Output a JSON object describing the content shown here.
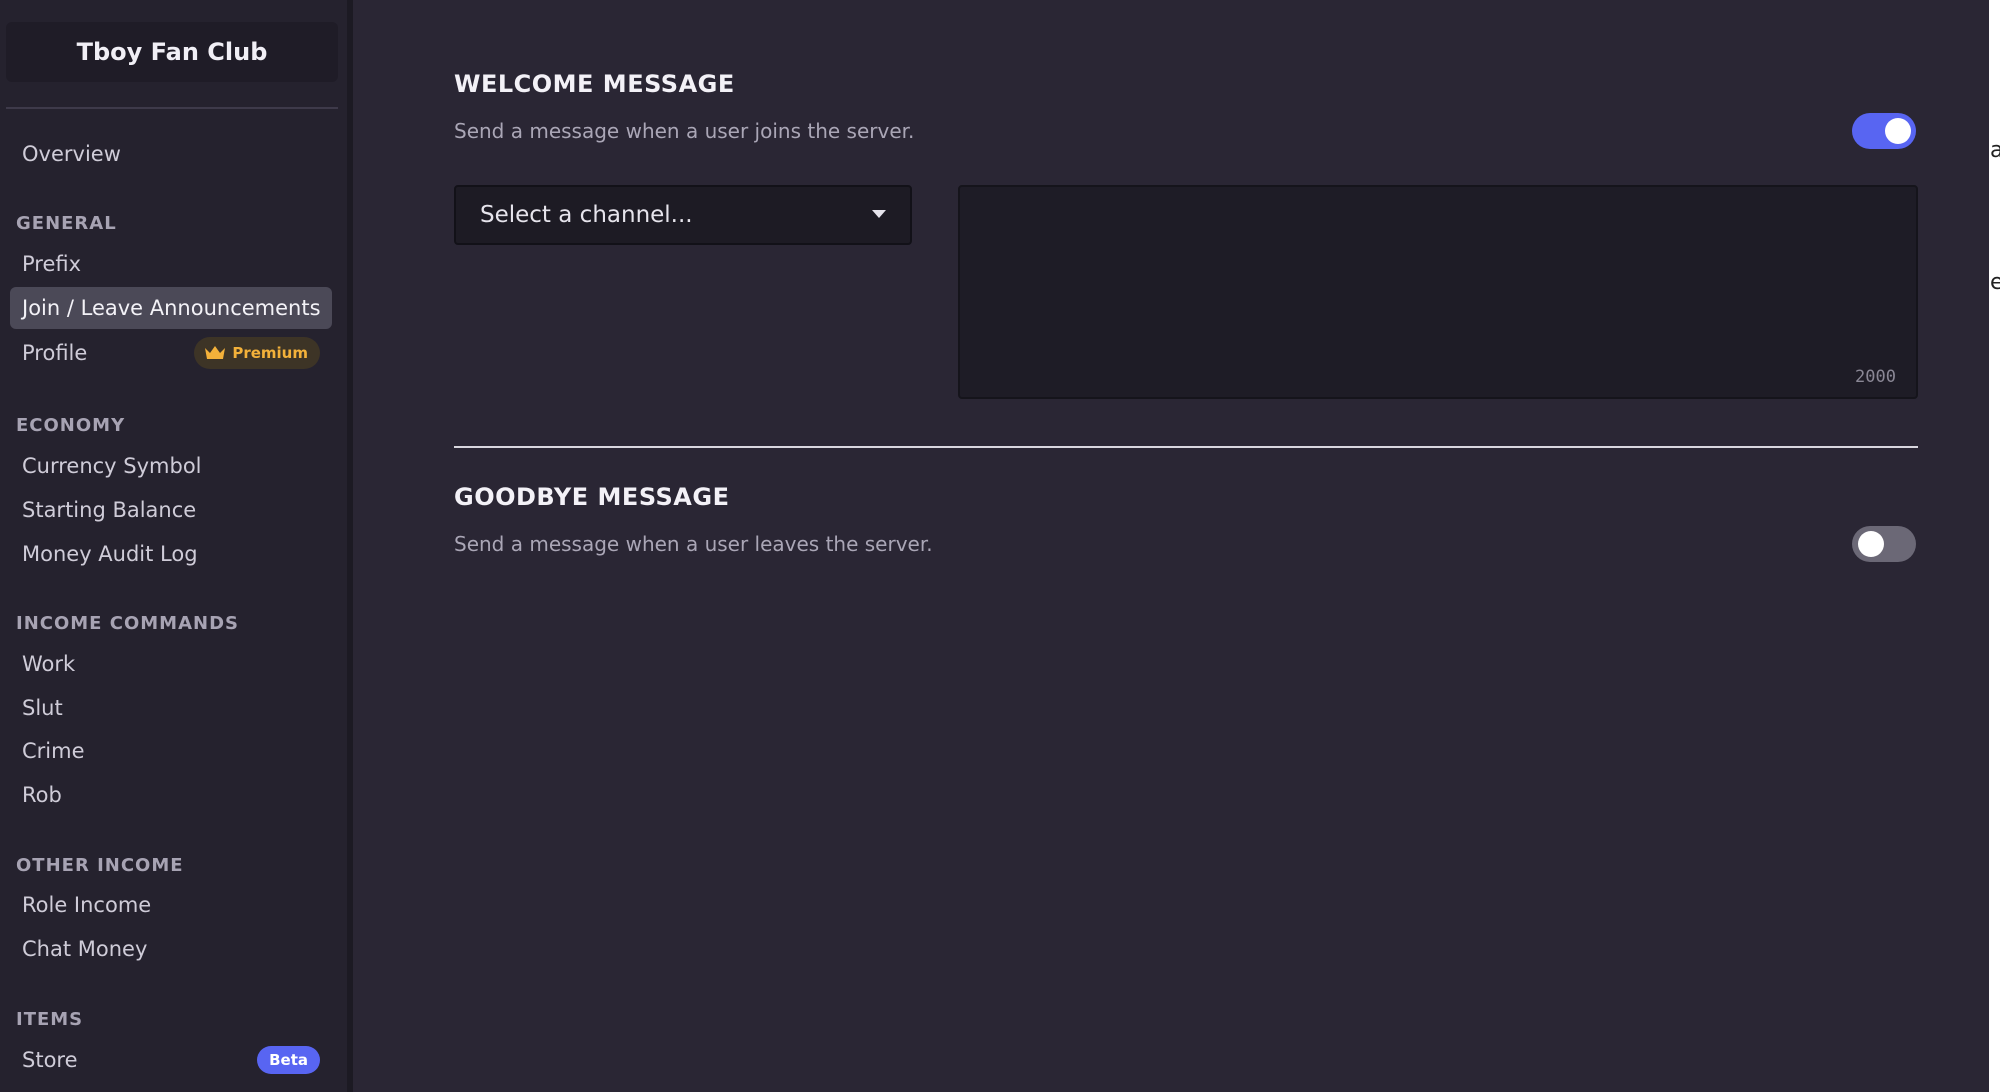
{
  "sidebar": {
    "server_name": "Tboy Fan Club",
    "overview": "Overview",
    "sections": {
      "general": "GENERAL",
      "economy": "ECONOMY",
      "income_commands": "INCOME COMMANDS",
      "other_income": "OTHER INCOME",
      "items": "ITEMS"
    },
    "items": {
      "prefix": "Prefix",
      "join_leave": "Join / Leave Announcements",
      "profile": "Profile",
      "premium_badge": "Premium",
      "currency_symbol": "Currency Symbol",
      "starting_balance": "Starting Balance",
      "money_audit_log": "Money Audit Log",
      "work": "Work",
      "slut": "Slut",
      "crime": "Crime",
      "rob": "Rob",
      "role_income": "Role Income",
      "chat_money": "Chat Money",
      "store": "Store",
      "beta_badge": "Beta"
    },
    "active_item": "Join / Leave Announcements"
  },
  "main": {
    "welcome": {
      "title": "WELCOME MESSAGE",
      "description": "Send a message when a user joins the server.",
      "enabled": true,
      "channel_placeholder": "Select a channel...",
      "message_value": "",
      "char_limit": "2000"
    },
    "goodbye": {
      "title": "GOODBYE MESSAGE",
      "description": "Send a message when a user leaves the server.",
      "enabled": false
    }
  },
  "edge_fragments": [
    "a",
    "e"
  ],
  "colors": {
    "accent": "#5865f2",
    "premium": "#f3b13a",
    "background": "#2a2634",
    "sidebar": "#25222e"
  },
  "icons": {
    "premium": "crown-icon",
    "select": "caret-down-icon"
  }
}
